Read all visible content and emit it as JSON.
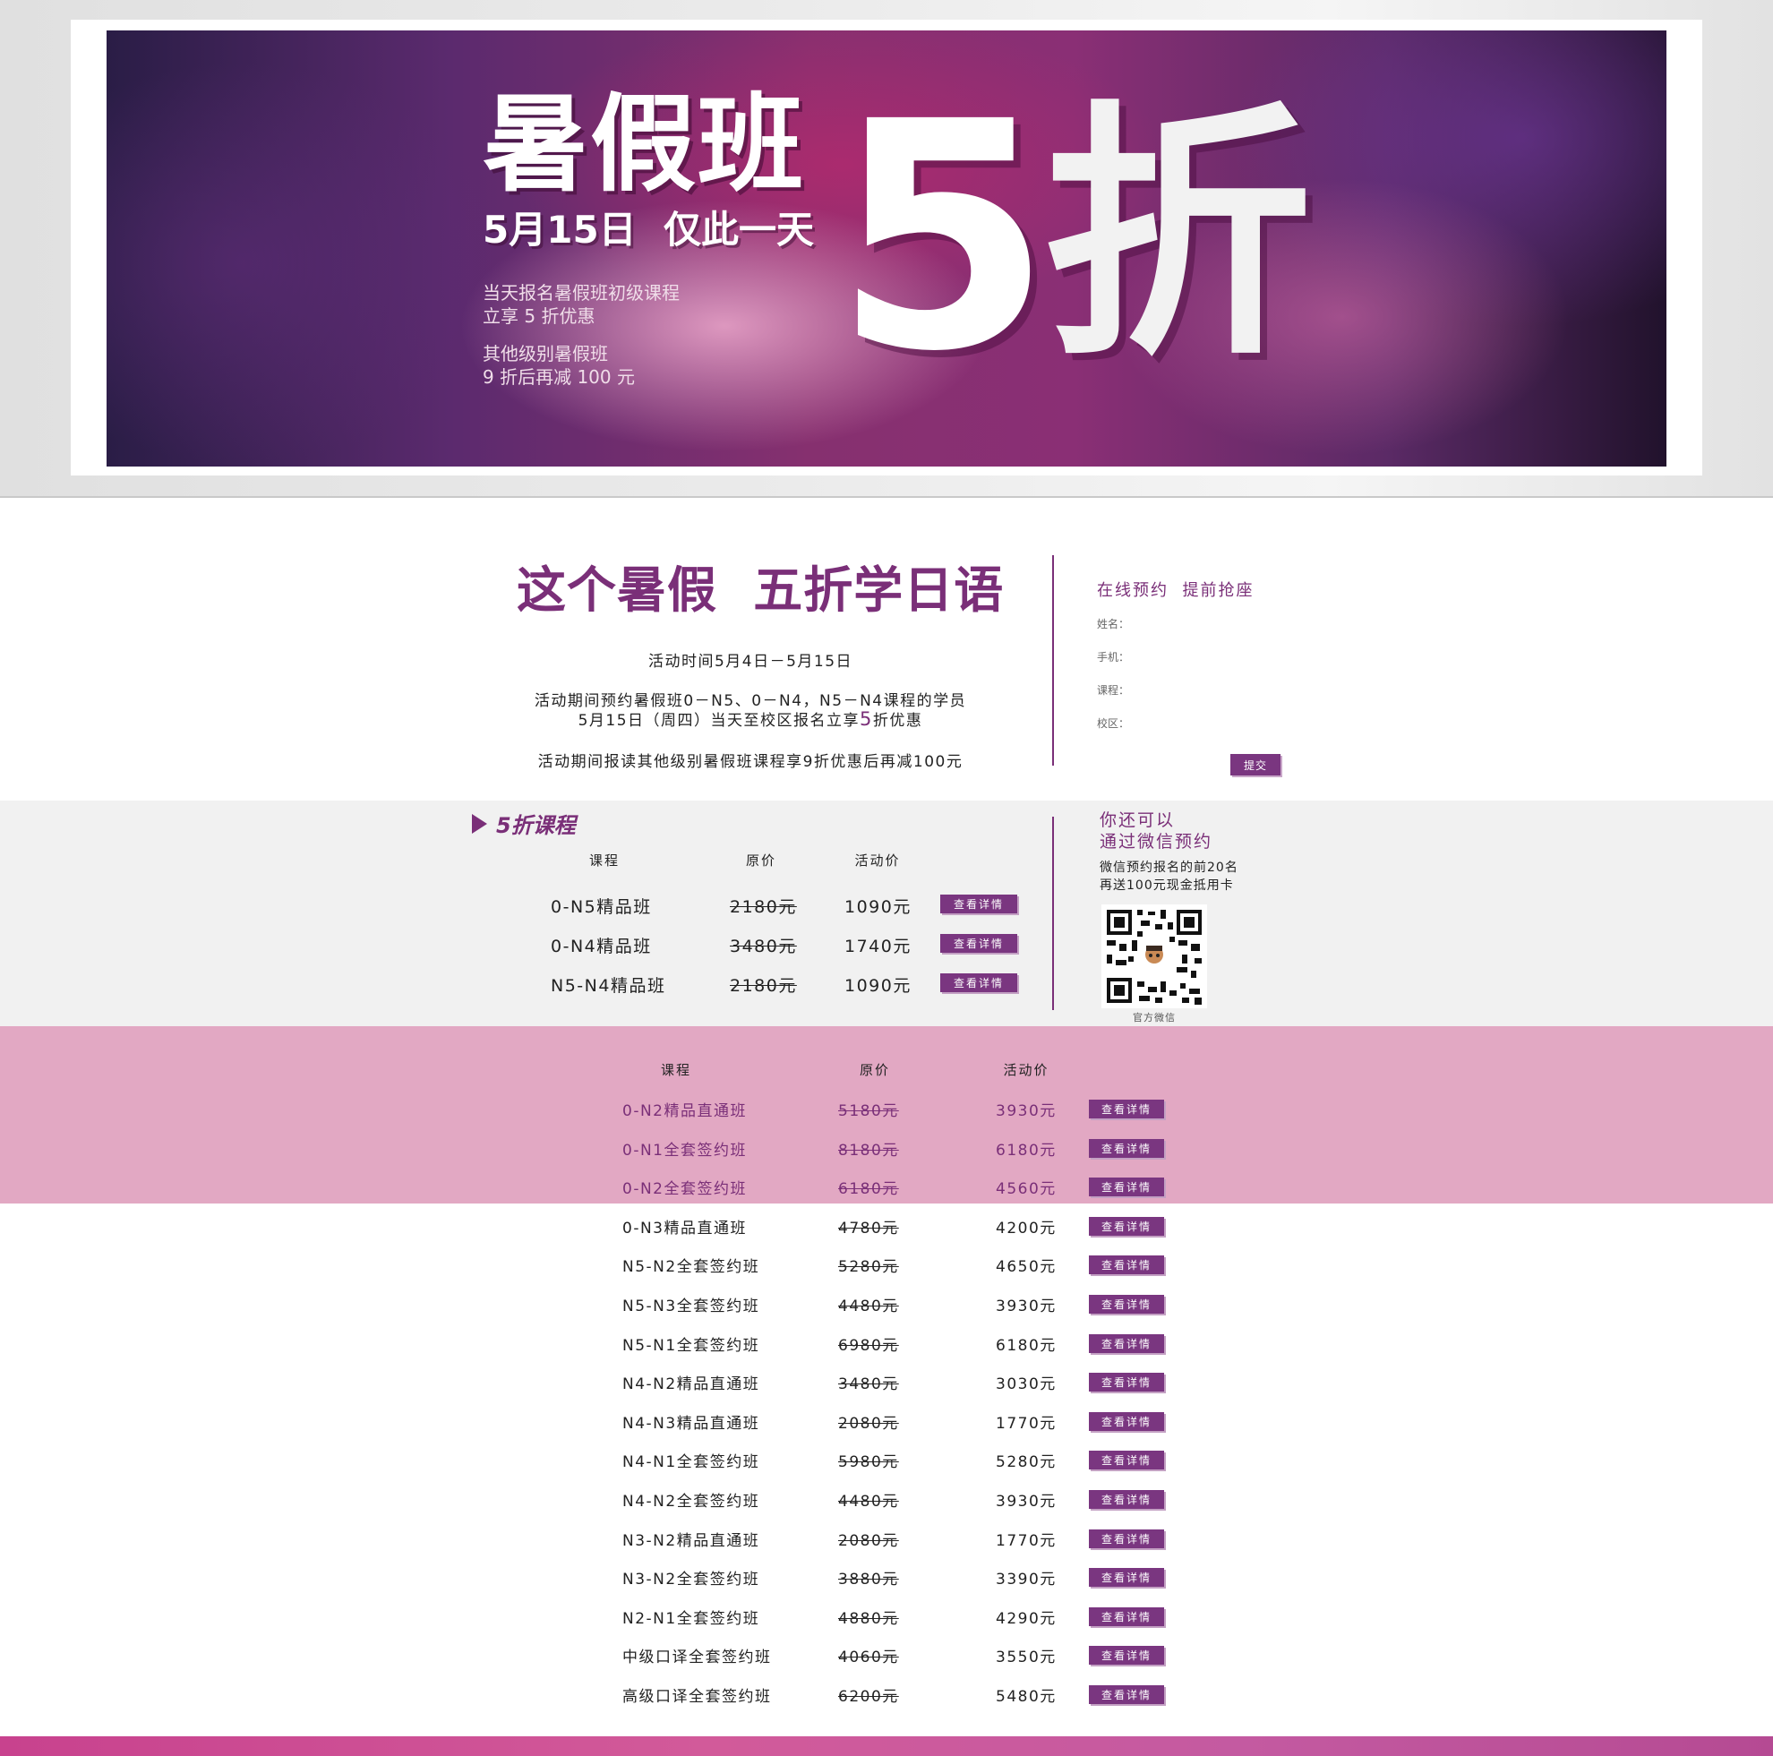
{
  "banner": {
    "title": "暑假班",
    "date": "5月15日",
    "once": "仅此一天",
    "big_number": "5",
    "big_char": "折",
    "desc": [
      "当天报名暑假班初级课程",
      "立享 5 折优惠",
      "其他级别暑假班",
      "9 折后再减 100 元"
    ]
  },
  "intro": {
    "title": "这个暑假  五折学日语",
    "time": "活动时间5月4日－5月15日",
    "line1": "活动期间预约暑假班0－N5、0－N4，N5－N4课程的学员",
    "line2_a": "5月15日（周四）当天至校区报名立享",
    "line2_hl": "5",
    "line2_b": "折优惠",
    "line3": "活动期间报读其他级别暑假班课程享9折优惠后再减100元"
  },
  "form": {
    "title": "在线预约  提前抢座",
    "fields": [
      {
        "label": "姓名：",
        "value": ""
      },
      {
        "label": "手机：",
        "value": ""
      },
      {
        "label": "课程：",
        "value": ""
      },
      {
        "label": "校区：",
        "value": ""
      }
    ],
    "submit_label": "提交"
  },
  "half_price": {
    "title": "5折课程",
    "headers": {
      "course": "课程",
      "orig": "原价",
      "price": "活动价"
    },
    "button_label": "查看详情",
    "rows": [
      {
        "course": "0-N5精品班",
        "orig": "2180元",
        "price": "1090元"
      },
      {
        "course": "0-N4精品班",
        "orig": "3480元",
        "price": "1740元"
      },
      {
        "course": "N5-N4精品班",
        "orig": "2180元",
        "price": "1090元"
      }
    ]
  },
  "wechat": {
    "title_1": "你还可以",
    "title_2": "通过微信预约",
    "note_1": "微信预约报名的前20名",
    "note_2": "再送100元现金抵用卡",
    "caption": "官方微信"
  },
  "all_courses": {
    "headers": {
      "course": "课程",
      "orig": "原价",
      "price": "活动价"
    },
    "button_label": "查看详情",
    "rows": [
      {
        "course": "0-N2精品直通班",
        "orig": "5180元",
        "price": "3930元"
      },
      {
        "course": "0-N1全套签约班",
        "orig": "8180元",
        "price": "6180元"
      },
      {
        "course": "0-N2全套签约班",
        "orig": "6180元",
        "price": "4560元"
      },
      {
        "course": "0-N3精品直通班",
        "orig": "4780元",
        "price": "4200元"
      },
      {
        "course": "N5-N2全套签约班",
        "orig": "5280元",
        "price": "4650元"
      },
      {
        "course": "N5-N3全套签约班",
        "orig": "4480元",
        "price": "3930元"
      },
      {
        "course": "N5-N1全套签约班",
        "orig": "6980元",
        "price": "6180元"
      },
      {
        "course": "N4-N2精品直通班",
        "orig": "3480元",
        "price": "3030元"
      },
      {
        "course": "N4-N3精品直通班",
        "orig": "2080元",
        "price": "1770元"
      },
      {
        "course": "N4-N1全套签约班",
        "orig": "5980元",
        "price": "5280元"
      },
      {
        "course": "N4-N2全套签约班",
        "orig": "4480元",
        "price": "3930元"
      },
      {
        "course": "N3-N2精品直通班",
        "orig": "2080元",
        "price": "1770元"
      },
      {
        "course": "N3-N2全套签约班",
        "orig": "3880元",
        "price": "3390元"
      },
      {
        "course": "N2-N1全套签约班",
        "orig": "4880元",
        "price": "4290元"
      },
      {
        "course": "中级口译全套签约班",
        "orig": "4060元",
        "price": "3550元"
      },
      {
        "course": "高级口译全套签约班",
        "orig": "6200元",
        "price": "5480元"
      }
    ]
  },
  "colors": {
    "accent": "#7a2f78",
    "button": "#7a3680",
    "pink_band": "#e2a8c3"
  }
}
